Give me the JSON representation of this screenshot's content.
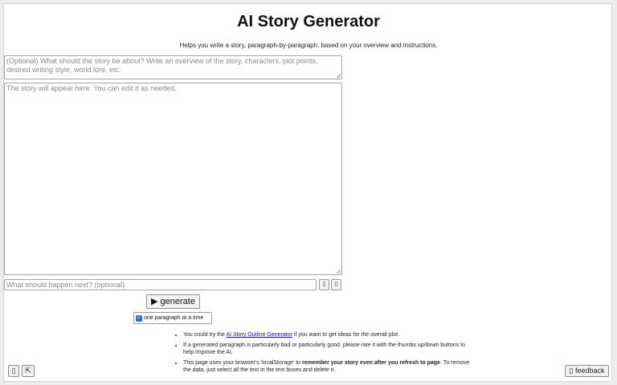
{
  "header": {
    "title": "AI Story Generator",
    "subtitle": "Helps you write a story, paragraph-by-paragraph, based on your overview and instructions."
  },
  "overview": {
    "placeholder": "(Optional) What should the story be about? Write an overview of the story, characters, plot points, desired writing style, world lore, etc.",
    "value": ""
  },
  "story": {
    "placeholder": "The story will appear here. You can edit it as needed.",
    "value": ""
  },
  "next": {
    "placeholder": "What should happen next? (optional)",
    "value": "",
    "thumbs_up_icon": "thumbs-up-icon",
    "thumbs_down_icon": "thumbs-down-icon"
  },
  "controls": {
    "generate_label": "▶ generate",
    "one_paragraph_label": "one paragraph at a time",
    "one_paragraph_checked": true
  },
  "tips": [
    {
      "before": "You could try the ",
      "link": "AI Story Outline Generator",
      "after": " if you want to get ideas for the overall plot."
    },
    {
      "text": "If a generated paragraph is particularly bad or particularly good, please rate it with the thumbs up/down buttons to help improve the AI."
    },
    {
      "before": "This page uses your browser's 'localStorage' to ",
      "bold": "remember your story even after you refresh to page",
      "after": ". To remove the data, just select all the text in the text boxes and delete it."
    }
  ],
  "footer": {
    "left_button_icon": "menu-icon",
    "expand_button_label": "⇱",
    "feedback_label": "▯ feedback"
  },
  "colors": {
    "accent": "#1a73e8",
    "link": "#1a0dab",
    "background": "#ffffff",
    "outer": "#ececec"
  }
}
